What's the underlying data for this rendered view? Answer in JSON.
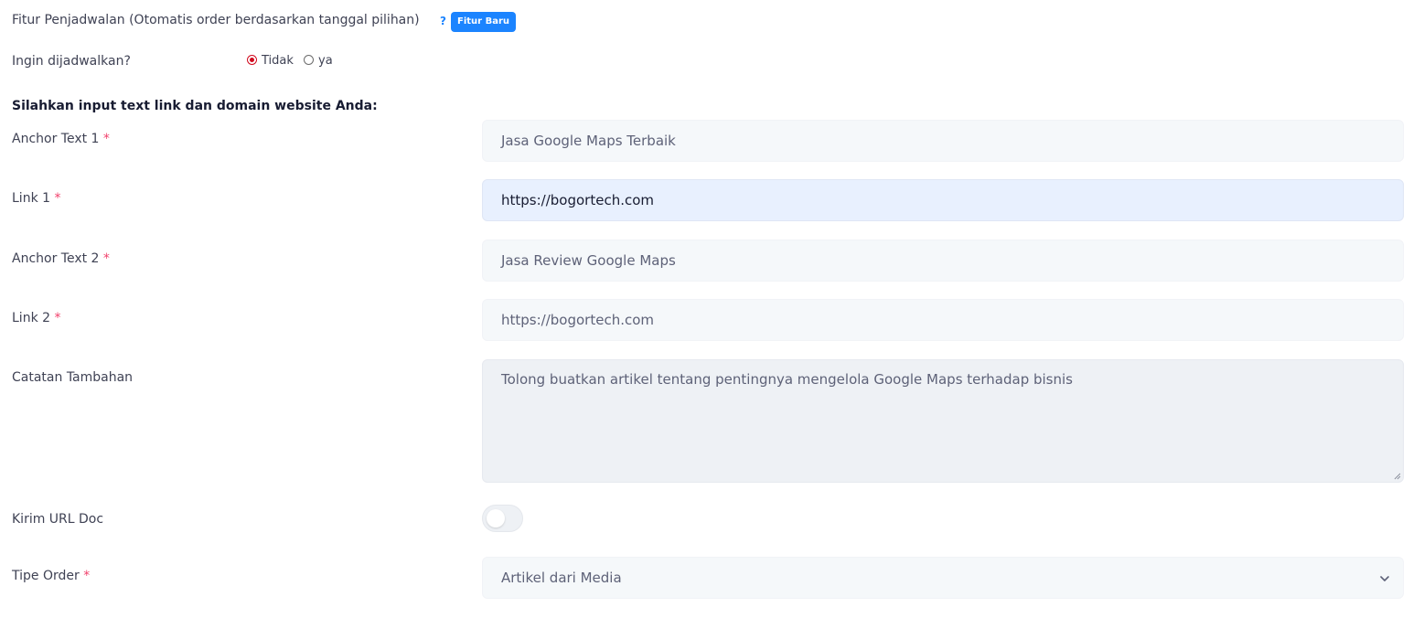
{
  "schedule": {
    "title": "Fitur Penjadwalan (Otomatis order berdasarkan tanggal pilihan)",
    "help_glyph": "?",
    "badge": "Fitur Baru",
    "question": "Ingin dijadwalkan?",
    "options": [
      {
        "label": "Tidak",
        "checked": true
      },
      {
        "label": "ya",
        "checked": false
      }
    ]
  },
  "section": {
    "heading": "Silahkan input text link dan domain website Anda:"
  },
  "fields": {
    "anchor1": {
      "label": "Anchor Text 1",
      "required": "*",
      "value": "Jasa Google Maps Terbaik"
    },
    "link1": {
      "label": "Link 1",
      "required": "*",
      "value": "https://bogortech.com"
    },
    "anchor2": {
      "label": "Anchor Text 2",
      "required": "*",
      "value": "Jasa Review Google Maps"
    },
    "link2": {
      "label": "Link 2",
      "required": "*",
      "value": "https://bogortech.com"
    },
    "notes": {
      "label": "Catatan Tambahan",
      "value": "Tolong buatkan artikel tentang pentingnya mengelola Google Maps terhadap bisnis"
    },
    "send_doc": {
      "label": "Kirim URL Doc",
      "enabled": false
    },
    "order_type": {
      "label": "Tipe Order",
      "required": "*",
      "value": "Artikel dari Media"
    }
  },
  "icons": {
    "help": "question-mark-icon",
    "select": "chevron-down-icon"
  },
  "colors": {
    "primary": "#1b84ff",
    "required": "#f1416c",
    "radio_checked": "#d10a1e",
    "input_bg": "#f5f8fa",
    "input_focus_bg": "#e8f0fe"
  }
}
